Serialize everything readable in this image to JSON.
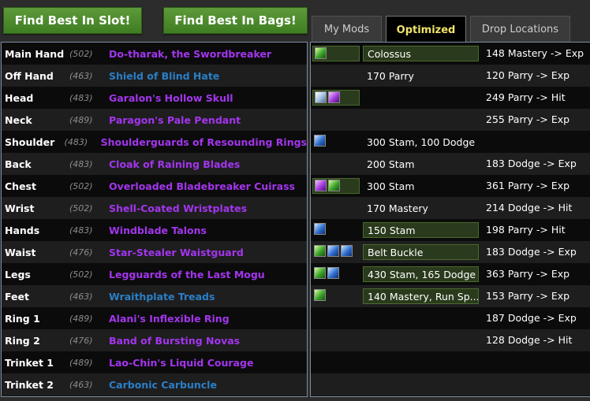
{
  "buttons": {
    "best_in_slot": "Find Best In Slot!",
    "best_in_bags": "Find Best In Bags!"
  },
  "tabs": [
    {
      "label": "My Mods",
      "active": false
    },
    {
      "label": "Optimized",
      "active": true
    },
    {
      "label": "Drop Locations",
      "active": false
    }
  ],
  "items": [
    {
      "slot": "Main Hand",
      "ilvl": "(502)",
      "name": "Do-tharak, the Swordbreaker",
      "quality": "purple",
      "gems": [
        "green"
      ],
      "gem_box": true,
      "enchant": "Colossus",
      "enchant_box": true,
      "reforge": "148 Mastery -> Exp"
    },
    {
      "slot": "Off Hand",
      "ilvl": "(463)",
      "name": "Shield of Blind Hate",
      "quality": "blue",
      "gems": [],
      "gem_box": false,
      "enchant": "170 Parry",
      "enchant_box": false,
      "reforge": "120 Parry -> Exp"
    },
    {
      "slot": "Head",
      "ilvl": "(483)",
      "name": "Garalon's Hollow Skull",
      "quality": "purple",
      "gems": [
        "meta",
        "purple"
      ],
      "gem_box": true,
      "enchant": "",
      "enchant_box": false,
      "reforge": "249 Parry -> Hit"
    },
    {
      "slot": "Neck",
      "ilvl": "(489)",
      "name": "Paragon's Pale Pendant",
      "quality": "purple",
      "gems": [],
      "gem_box": false,
      "enchant": "",
      "enchant_box": false,
      "reforge": "255 Parry -> Exp"
    },
    {
      "slot": "Shoulder",
      "ilvl": "(483)",
      "name": "Shoulderguards of Resounding Rings",
      "quality": "purple",
      "gems": [
        "blue"
      ],
      "gem_box": false,
      "enchant": "300 Stam, 100 Dodge",
      "enchant_box": false,
      "reforge": ""
    },
    {
      "slot": "Back",
      "ilvl": "(483)",
      "name": "Cloak of Raining Blades",
      "quality": "purple",
      "gems": [],
      "gem_box": false,
      "enchant": "200 Stam",
      "enchant_box": false,
      "reforge": "183 Dodge -> Exp"
    },
    {
      "slot": "Chest",
      "ilvl": "(502)",
      "name": "Overloaded Bladebreaker Cuirass",
      "quality": "purple",
      "gems": [
        "purple",
        "green"
      ],
      "gem_box": true,
      "enchant": "300 Stam",
      "enchant_box": false,
      "reforge": "361 Parry -> Exp"
    },
    {
      "slot": "Wrist",
      "ilvl": "(502)",
      "name": "Shell-Coated Wristplates",
      "quality": "purple",
      "gems": [],
      "gem_box": false,
      "enchant": "170 Mastery",
      "enchant_box": false,
      "reforge": "214 Dodge -> Hit"
    },
    {
      "slot": "Hands",
      "ilvl": "(483)",
      "name": "Windblade Talons",
      "quality": "purple",
      "gems": [
        "blue"
      ],
      "gem_box": false,
      "enchant": "150 Stam",
      "enchant_box": true,
      "reforge": "198 Parry -> Hit"
    },
    {
      "slot": "Waist",
      "ilvl": "(476)",
      "name": "Star-Stealer Waistguard",
      "quality": "purple",
      "gems": [
        "green",
        "blue",
        "blue"
      ],
      "gem_box": false,
      "enchant": "Belt Buckle",
      "enchant_box": true,
      "reforge": "183 Dodge -> Exp"
    },
    {
      "slot": "Legs",
      "ilvl": "(502)",
      "name": "Legguards of the Last Mogu",
      "quality": "purple",
      "gems": [
        "green",
        "blue"
      ],
      "gem_box": false,
      "enchant": "430 Stam, 165 Dodge",
      "enchant_box": true,
      "reforge": "363 Parry -> Exp"
    },
    {
      "slot": "Feet",
      "ilvl": "(463)",
      "name": "Wraithplate Treads",
      "quality": "blue",
      "gems": [
        "green"
      ],
      "gem_box": false,
      "enchant": "140 Mastery, Run Sp...",
      "enchant_box": true,
      "reforge": "153 Parry -> Exp"
    },
    {
      "slot": "Ring 1",
      "ilvl": "(489)",
      "name": "Alani's Inflexible Ring",
      "quality": "purple",
      "gems": [],
      "gem_box": false,
      "enchant": "",
      "enchant_box": false,
      "reforge": "187 Dodge -> Exp"
    },
    {
      "slot": "Ring 2",
      "ilvl": "(476)",
      "name": "Band of Bursting Novas",
      "quality": "purple",
      "gems": [],
      "gem_box": false,
      "enchant": "",
      "enchant_box": false,
      "reforge": "128 Dodge -> Hit"
    },
    {
      "slot": "Trinket 1",
      "ilvl": "(489)",
      "name": "Lao-Chin's Liquid Courage",
      "quality": "purple",
      "gems": [],
      "gem_box": false,
      "enchant": "",
      "enchant_box": false,
      "reforge": ""
    },
    {
      "slot": "Trinket 2",
      "ilvl": "(463)",
      "name": "Carbonic Carbuncle",
      "quality": "blue",
      "gems": [],
      "gem_box": false,
      "enchant": "",
      "enchant_box": false,
      "reforge": ""
    }
  ]
}
